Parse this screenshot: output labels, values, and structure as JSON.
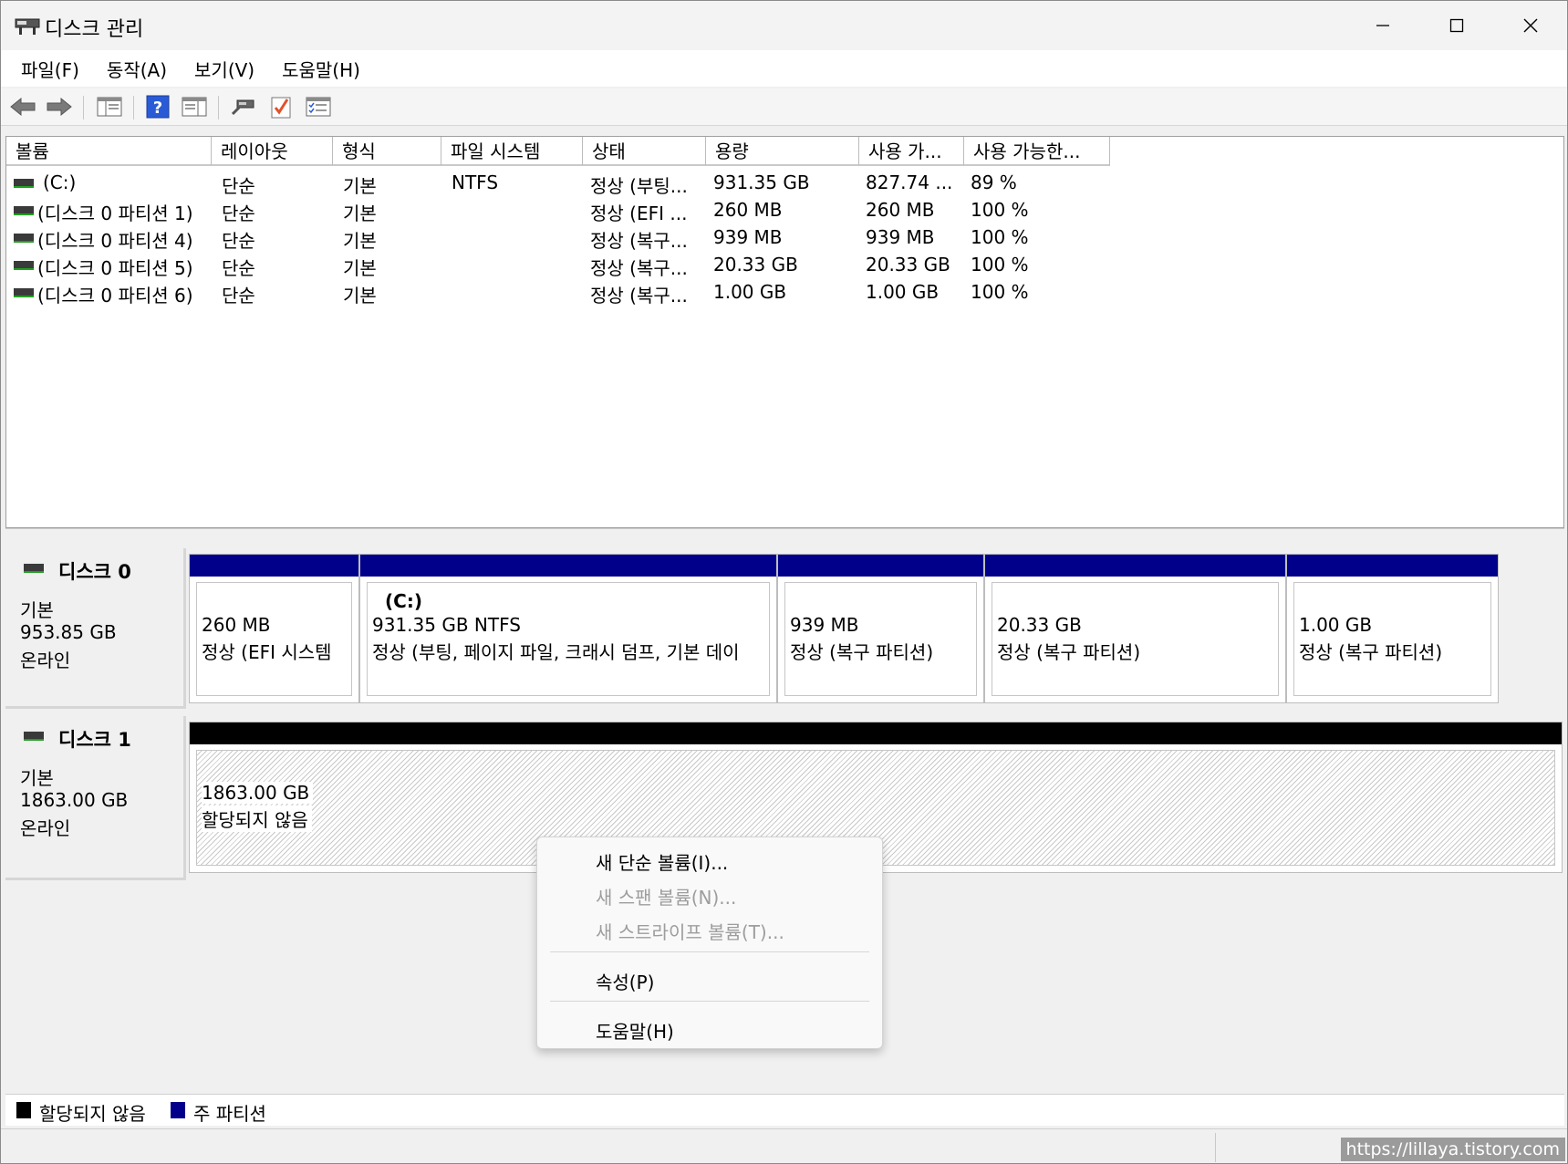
{
  "window": {
    "title": "디스크 관리"
  },
  "menu": [
    "파일(F)",
    "동작(A)",
    "보기(V)",
    "도움말(H)"
  ],
  "toolbar": {
    "icons": [
      "back-icon",
      "forward-icon",
      "console-tree-icon",
      "help-icon",
      "action-pane-icon",
      "connect-icon",
      "checklist-icon",
      "properties-icon"
    ]
  },
  "table": {
    "columns": [
      "볼륨",
      "레이아웃",
      "형식",
      "파일 시스템",
      "상태",
      "용량",
      "사용 가...",
      "사용 가능한..."
    ],
    "rows": [
      [
        "(C:)",
        "단순",
        "기본",
        "NTFS",
        "정상 (부팅...",
        "931.35 GB",
        "827.74 ...",
        "89 %"
      ],
      [
        "(디스크 0 파티션 1)",
        "단순",
        "기본",
        "",
        "정상 (EFI ...",
        "260 MB",
        "260 MB",
        "100 %"
      ],
      [
        "(디스크 0 파티션 4)",
        "단순",
        "기본",
        "",
        "정상 (복구...",
        "939 MB",
        "939 MB",
        "100 %"
      ],
      [
        "(디스크 0 파티션 5)",
        "단순",
        "기본",
        "",
        "정상 (복구...",
        "20.33 GB",
        "20.33 GB",
        "100 %"
      ],
      [
        "(디스크 0 파티션 6)",
        "단순",
        "기본",
        "",
        "정상 (복구...",
        "1.00 GB",
        "1.00 GB",
        "100 %"
      ]
    ]
  },
  "disks": [
    {
      "name": "디스크 0",
      "type": "기본",
      "size": "953.85 GB",
      "status": "온라인",
      "partitions": [
        {
          "title": "",
          "size": "260 MB",
          "status": "정상 (EFI 시스템"
        },
        {
          "title": "(C:)",
          "size": "931.35 GB NTFS",
          "status": "정상 (부팅, 페이지 파일, 크래시 덤프, 기본 데이"
        },
        {
          "title": "",
          "size": "939 MB",
          "status": "정상 (복구 파티션)"
        },
        {
          "title": "",
          "size": "20.33 GB",
          "status": "정상 (복구 파티션)"
        },
        {
          "title": "",
          "size": "1.00 GB",
          "status": "정상 (복구 파티션)"
        }
      ]
    },
    {
      "name": "디스크 1",
      "type": "기본",
      "size": "1863.00 GB",
      "status": "온라인",
      "partitions": [
        {
          "title": "",
          "size": "1863.00 GB",
          "status": "할당되지 않음"
        }
      ]
    }
  ],
  "context_menu": {
    "items": [
      {
        "label": "새 단순 볼륨(I)...",
        "enabled": true
      },
      {
        "label": "새 스팬 볼륨(N)...",
        "enabled": false
      },
      {
        "label": "새 스트라이프 볼륨(T)...",
        "enabled": false
      },
      {
        "label": "속성(P)",
        "enabled": true
      },
      {
        "label": "도움말(H)",
        "enabled": true
      }
    ]
  },
  "legend": {
    "unallocated": {
      "label": "할당되지 않음",
      "color": "#000000"
    },
    "primary": {
      "label": "주 파티션",
      "color": "#00008b"
    }
  },
  "watermark": "https://lillaya.tistory.com"
}
